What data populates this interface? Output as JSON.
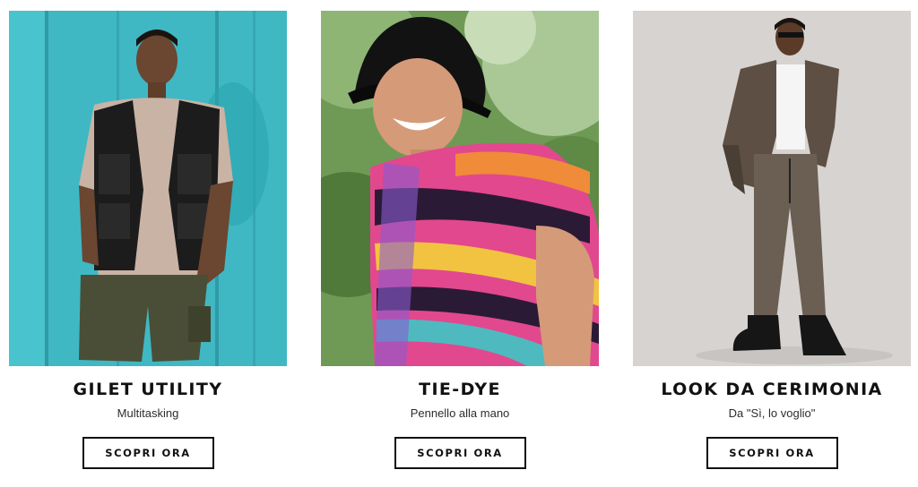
{
  "cards": [
    {
      "title": "GILET UTILITY",
      "subtitle": "Multitasking",
      "button_label": "SCOPRI ORA",
      "image": "man-in-utility-vest-against-turquoise-wall"
    },
    {
      "title": "TIE-DYE",
      "subtitle": "Pennello alla mano",
      "button_label": "SCOPRI ORA",
      "image": "smiling-man-in-bucket-hat-and-tie-dye-tee"
    },
    {
      "title": "LOOK DA CERIMONIA",
      "subtitle": "Da \"Sì, lo voglio\"",
      "button_label": "SCOPRI ORA",
      "image": "man-in-checked-suit-on-grey-backdrop"
    }
  ],
  "colors": {
    "text": "#111111",
    "subtext": "#2d2d2d",
    "button_border": "#111111",
    "background": "#ffffff"
  }
}
